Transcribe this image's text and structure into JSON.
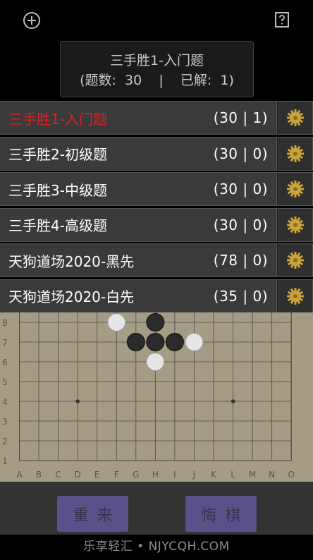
{
  "header": {
    "add_icon": "plus-circle-icon",
    "help_icon": "question-box-icon"
  },
  "info": {
    "title": "三手胜1-入门题",
    "stats": "(题数:  30    |    已解:  1)"
  },
  "levels": [
    {
      "name": "三手胜1-入门题",
      "count": "(30 | 1)",
      "active": true
    },
    {
      "name": "三手胜2-初级题",
      "count": "(30 | 0)",
      "active": false
    },
    {
      "name": "三手胜3-中级题",
      "count": "(30 | 0)",
      "active": false
    },
    {
      "name": "三手胜4-高级题",
      "count": "(30 | 0)",
      "active": false
    },
    {
      "name": "天狗道场2020-黑先",
      "count": "(78 | 0)",
      "active": false
    },
    {
      "name": "天狗道场2020-白先",
      "count": "(35 | 0)",
      "active": false
    }
  ],
  "colors": {
    "active_level": "#e02020",
    "gear": "#c8a43c",
    "board": "#a59c85",
    "button": "#6a5aa8"
  },
  "board": {
    "row_labels": [
      "8",
      "7",
      "6",
      "5",
      "4",
      "3",
      "2",
      "1"
    ],
    "col_labels": [
      "A",
      "B",
      "C",
      "D",
      "E",
      "F",
      "G",
      "H",
      "I",
      "J",
      "K",
      "L",
      "M",
      "N",
      "O"
    ],
    "stones": [
      {
        "col": "F",
        "row": 8,
        "color": "white"
      },
      {
        "col": "H",
        "row": 8,
        "color": "black"
      },
      {
        "col": "G",
        "row": 7,
        "color": "black"
      },
      {
        "col": "H",
        "row": 7,
        "color": "black"
      },
      {
        "col": "I",
        "row": 7,
        "color": "black"
      },
      {
        "col": "J",
        "row": 7,
        "color": "white"
      },
      {
        "col": "H",
        "row": 6,
        "color": "white"
      }
    ],
    "star_points": [
      {
        "col": "D",
        "row": 4
      },
      {
        "col": "L",
        "row": 4
      }
    ]
  },
  "actions": {
    "restart": "重来",
    "undo": "悔棋"
  },
  "watermark": "乐享轻汇 • NJYCQH.COM"
}
